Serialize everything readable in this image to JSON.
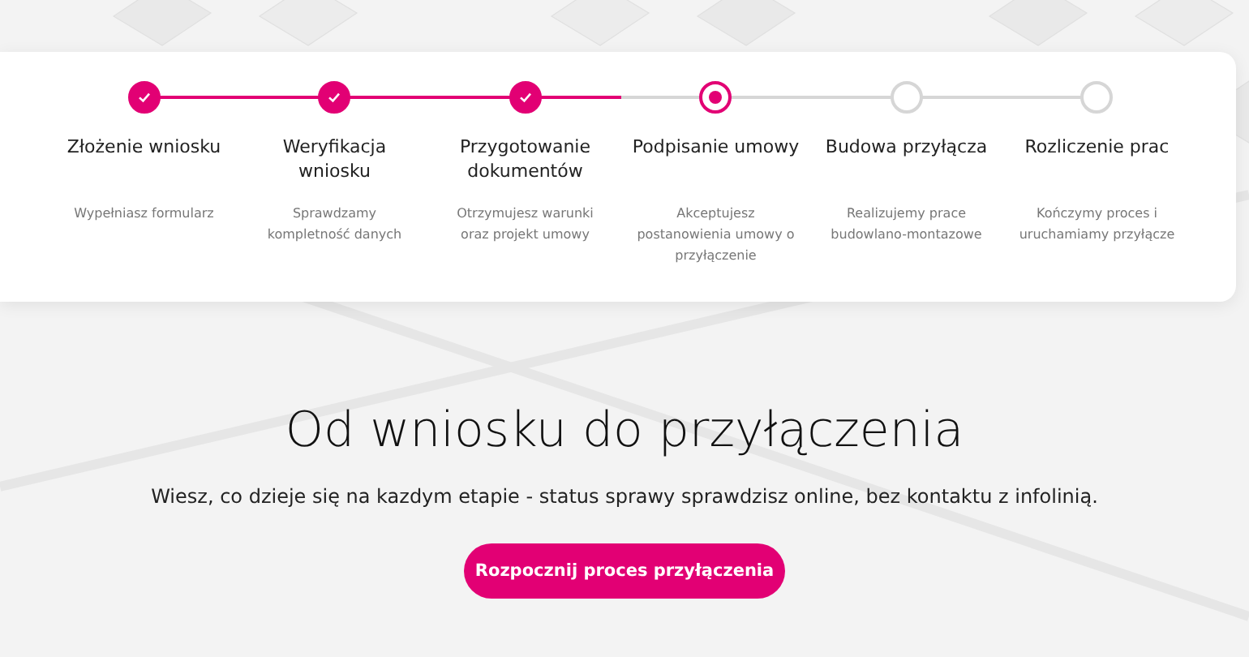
{
  "steps": [
    {
      "title": "Złożenie wniosku",
      "description": "Wypełniasz formularz",
      "completed": true,
      "selected": false
    },
    {
      "title": "Weryfikacja wniosku",
      "description": "Sprawdzamy kompletność danych",
      "completed": true,
      "selected": false
    },
    {
      "title": "Przygotowanie dokumentów",
      "description": "Otrzymujesz warunki oraz projekt umowy",
      "completed": true,
      "selected": false
    },
    {
      "title": "Podpisanie umowy",
      "description": "Akceptujesz postanowienia umowy o przyłączenie",
      "completed": false,
      "selected": true
    },
    {
      "title": "Budowa przyłącza",
      "description": "Realizujemy prace budowlano-montazowe",
      "completed": false,
      "selected": false
    },
    {
      "title": "Rozliczenie prac",
      "description": "Kończymy proces i uruchamiamy przyłącze",
      "completed": false,
      "selected": false
    }
  ],
  "heading": "Od wniosku do przyłączenia",
  "subtitle": "Wiesz, co dzieje się na kazdym etapie - status sprawy sprawdzisz online, bez kontaktu z infolinią.",
  "cta": "Rozpocznij proces przyłączenia"
}
